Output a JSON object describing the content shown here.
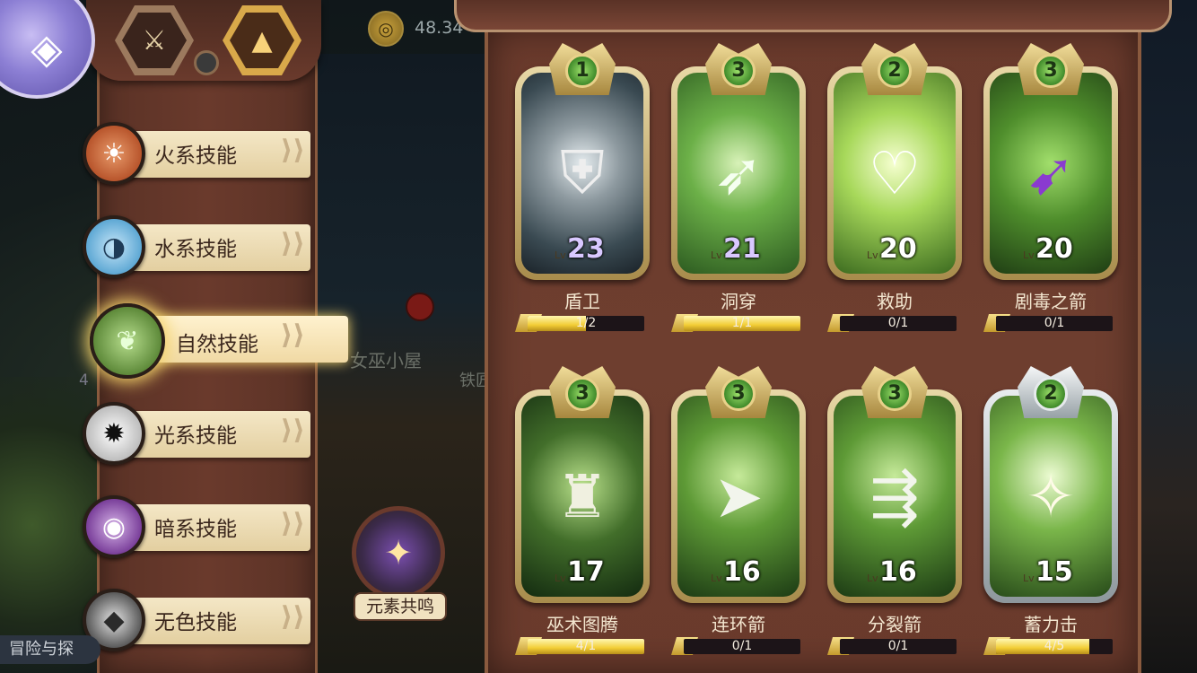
{
  "top": {
    "currency_value": "48.34",
    "sword_icon": "sword-icon",
    "triangle_icon": "triangle-stack-icon"
  },
  "categories": [
    {
      "label": "火系技能",
      "icon": "fire-element-icon",
      "active": false
    },
    {
      "label": "水系技能",
      "icon": "water-element-icon",
      "active": false
    },
    {
      "label": "自然技能",
      "icon": "nature-leaf-icon",
      "active": true
    },
    {
      "label": "光系技能",
      "icon": "light-sun-icon",
      "active": false
    },
    {
      "label": "暗系技能",
      "icon": "dark-swirl-icon",
      "active": false
    },
    {
      "label": "无色技能",
      "icon": "colorless-diamond-icon",
      "active": false
    }
  ],
  "background": {
    "hut_label": "女巫小屋",
    "iron_label": "铁匠",
    "left_fragment": "4",
    "left_bottom_label": "冒险与探"
  },
  "resonance": {
    "label": "元素共鸣"
  },
  "skills": [
    {
      "name": "盾卫",
      "tier": "1",
      "lv_prefix": "Lv",
      "level": "23",
      "progress_text": "1/2",
      "progress": 0.5
    },
    {
      "name": "洞穿",
      "tier": "3",
      "lv_prefix": "Lv",
      "level": "21",
      "progress_text": "1/1",
      "progress": 1.0
    },
    {
      "name": "救助",
      "tier": "2",
      "lv_prefix": "Lv",
      "level": "20",
      "progress_text": "0/1",
      "progress": 0.0
    },
    {
      "name": "剧毒之箭",
      "tier": "3",
      "lv_prefix": "Lv",
      "level": "20",
      "progress_text": "0/1",
      "progress": 0.0
    },
    {
      "name": "巫术图腾",
      "tier": "3",
      "lv_prefix": "Lv",
      "level": "17",
      "progress_text": "4/1",
      "progress": 1.0
    },
    {
      "name": "连环箭",
      "tier": "3",
      "lv_prefix": "Lv",
      "level": "16",
      "progress_text": "0/1",
      "progress": 0.0
    },
    {
      "name": "分裂箭",
      "tier": "3",
      "lv_prefix": "Lv",
      "level": "16",
      "progress_text": "0/1",
      "progress": 0.0
    },
    {
      "name": "蓄力击",
      "tier": "2",
      "lv_prefix": "Lv",
      "level": "15",
      "progress_text": "4/5",
      "progress": 0.8
    }
  ]
}
